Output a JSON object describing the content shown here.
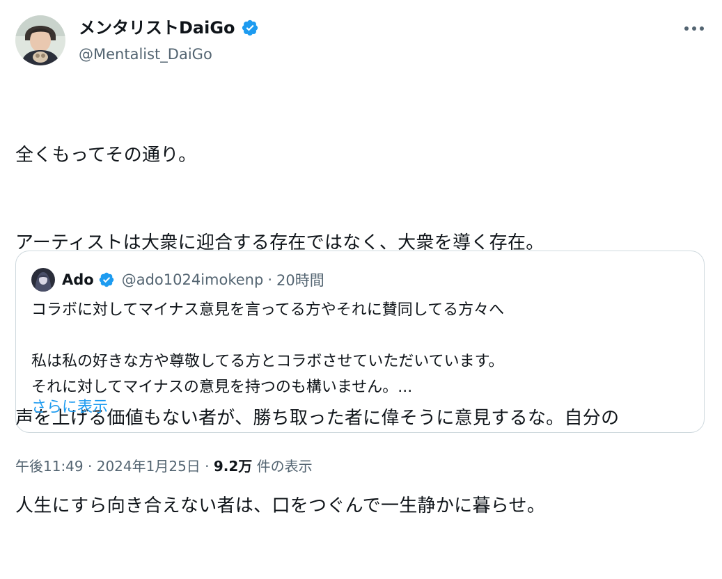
{
  "author": {
    "name": "メンタリストDaiGo",
    "handle": "@Mentalist_DaiGo",
    "verified": true
  },
  "tweet": {
    "lines": [
      "全くもってその通り。",
      "アーティストは大衆に迎合する存在ではなく、大衆を導く存在。",
      "",
      "声を上げる価値もない者が、勝ち取った者に偉そうに意見するな。自分の",
      "人生にすら向き合えない者は、口をつぐんで一生静かに暮らせ。"
    ]
  },
  "quote": {
    "name": "Ado",
    "handle": "@ado1024imokenp",
    "separator": "·",
    "time": "20時間",
    "lines": [
      "コラボに対してマイナス意見を言ってる方やそれに賛同してる方々へ",
      "",
      "私は私の好きな方や尊敬してる方とコラボさせていただいています。",
      "それに対してマイナスの意見を持つのも構いません。..."
    ],
    "show_more_label": "さらに表示"
  },
  "meta": {
    "time": "午後11:49",
    "sep1": " · ",
    "date": "2024年1月25日",
    "sep2": " · ",
    "views_count": "9.2万",
    "views_label": " 件の表示"
  },
  "icons": {
    "verified": "verified-badge-icon",
    "more": "more-dots-icon"
  },
  "colors": {
    "verified_blue": "#1d9bf0",
    "link_blue": "#1d9bf0",
    "secondary_text": "#536471",
    "primary_text": "#0f1419",
    "border": "#cfd9de"
  }
}
